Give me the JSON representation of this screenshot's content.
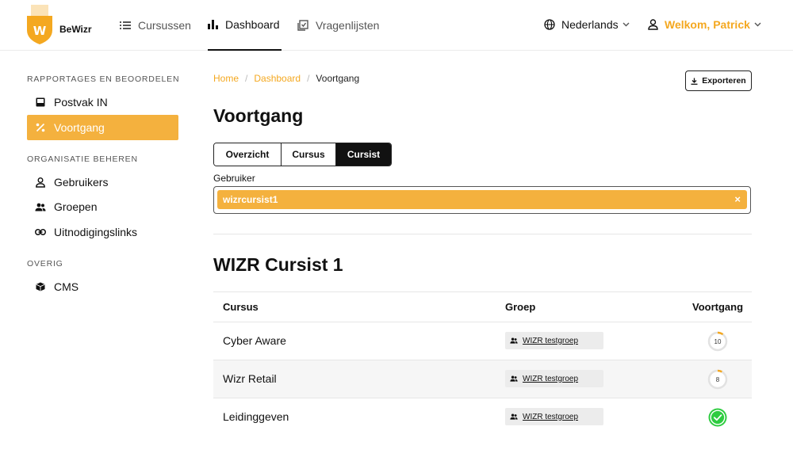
{
  "brand": {
    "name": "BeWizr",
    "logo_letter": "W",
    "color": "#f4a820"
  },
  "nav": {
    "items": [
      {
        "label": "Cursussen",
        "icon": "list-icon",
        "active": false
      },
      {
        "label": "Dashboard",
        "icon": "bar-chart-icon",
        "active": true
      },
      {
        "label": "Vragenlijsten",
        "icon": "checklist-icon",
        "active": false
      }
    ],
    "language": "Nederlands",
    "user": "Welkom, Patrick"
  },
  "sidebar": {
    "sections": [
      {
        "heading": "RAPPORTAGES EN BEOORDELEN"
      },
      {
        "heading": "ORGANISATIE BEHEREN"
      },
      {
        "heading": "OVERIG"
      }
    ],
    "items": [
      {
        "label": "Postvak IN",
        "icon": "inbox-icon",
        "active": false
      },
      {
        "label": "Voortgang",
        "icon": "percent-icon",
        "active": true
      },
      {
        "label": "Gebruikers",
        "icon": "user-icon",
        "active": false
      },
      {
        "label": "Groepen",
        "icon": "users-icon",
        "active": false
      },
      {
        "label": "Uitnodigingslinks",
        "icon": "link-icon",
        "active": false
      },
      {
        "label": "CMS",
        "icon": "cube-icon",
        "active": false
      }
    ]
  },
  "breadcrumb": {
    "home": "Home",
    "dashboard": "Dashboard",
    "current": "Voortgang",
    "separator": "/"
  },
  "export_label": "Exporteren",
  "page_title": "Voortgang",
  "tabs": [
    {
      "label": "Overzicht",
      "active": false
    },
    {
      "label": "Cursus",
      "active": false
    },
    {
      "label": "Cursist",
      "active": true
    }
  ],
  "filter": {
    "label": "Gebruiker",
    "value": "wizrcursist1",
    "clear": "×"
  },
  "section_title": "WIZR Cursist 1",
  "table": {
    "columns": {
      "course": "Cursus",
      "group": "Groep",
      "progress": "Voortgang"
    },
    "rows": [
      {
        "course": "Cyber Aware",
        "group": "WIZR testgroep",
        "progress": 10,
        "progress_label": "10",
        "complete": false
      },
      {
        "course": "Wizr Retail",
        "group": "WIZR testgroep",
        "progress": 8,
        "progress_label": "8",
        "complete": false
      },
      {
        "course": "Leidinggeven",
        "group": "WIZR testgroep",
        "progress": 100,
        "progress_label": "",
        "complete": true
      }
    ]
  },
  "colors": {
    "accent": "#f4b13e",
    "complete": "#2ecc40",
    "active_tab": "#111111"
  }
}
